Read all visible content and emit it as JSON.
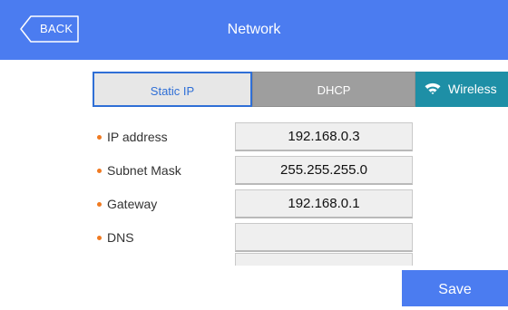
{
  "header": {
    "back_label": "BACK",
    "title": "Network"
  },
  "tabs": {
    "static_label": "Static IP",
    "dhcp_label": "DHCP",
    "wireless_label": "Wireless",
    "selected": "Static IP",
    "wireless_icon": "wifi-icon"
  },
  "fields": {
    "ip": {
      "label": "IP address",
      "value": "192.168.0.3"
    },
    "subnet": {
      "label": "Subnet Mask",
      "value": "255.255.255.0"
    },
    "gateway": {
      "label": "Gateway",
      "value": "192.168.0.1"
    },
    "dns": {
      "label": "DNS",
      "value": ""
    },
    "dns2": {
      "value": ""
    }
  },
  "actions": {
    "save_label": "Save"
  },
  "colors": {
    "accent": "#4b7cf0",
    "wireless": "#1e8fa6",
    "bullet": "#f07a21"
  }
}
